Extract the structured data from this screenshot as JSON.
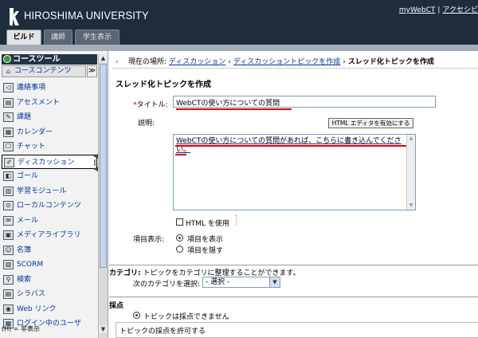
{
  "header": {
    "university": "HIROSHIMA UNIVERSITY",
    "links": [
      "myWebCT",
      "アクセシビ"
    ],
    "separator": "|"
  },
  "tabs": [
    {
      "label": "ビルド",
      "active": true
    },
    {
      "label": "講師",
      "active": false
    },
    {
      "label": "学生表示",
      "active": false
    }
  ],
  "sidebar": {
    "heading": "コースツール",
    "subheading": "コースコンテンツ",
    "collapse_icon": "≫",
    "items": [
      {
        "label": "連絡事項",
        "icon": "megaphone-icon",
        "glyph": "◁"
      },
      {
        "label": "アセスメント",
        "icon": "assessment-icon",
        "glyph": "▤"
      },
      {
        "label": "課題",
        "icon": "assignment-icon",
        "glyph": "✎"
      },
      {
        "label": "カレンダー",
        "icon": "calendar-icon",
        "glyph": "▦"
      },
      {
        "label": "チャット",
        "icon": "chat-icon",
        "glyph": "☐"
      },
      {
        "label": "ディスカッション",
        "icon": "discussion-icon",
        "glyph": "✐",
        "selected": true
      },
      {
        "label": "ゴール",
        "icon": "goal-icon",
        "glyph": "◧"
      },
      {
        "label": "学習モジュール",
        "icon": "learning-module-icon",
        "glyph": "▥"
      },
      {
        "label": "ローカルコンテンツ",
        "icon": "local-content-icon",
        "glyph": "⊙"
      },
      {
        "label": "メール",
        "icon": "mail-icon",
        "glyph": "✉"
      },
      {
        "label": "メディアライブラリ",
        "icon": "media-library-icon",
        "glyph": "▣"
      },
      {
        "label": "名簿",
        "icon": "roster-icon",
        "glyph": "☺"
      },
      {
        "label": "SCORM",
        "icon": "scorm-icon",
        "glyph": "▧"
      },
      {
        "label": "検索",
        "icon": "search-icon",
        "glyph": "⚲"
      },
      {
        "label": "シラバス",
        "icon": "syllabus-icon",
        "glyph": "▤"
      },
      {
        "label": "Web リンク",
        "icon": "web-link-icon",
        "glyph": "◉"
      },
      {
        "label": "ログイン中のユーザ",
        "icon": "online-users-icon",
        "glyph": "▦"
      }
    ],
    "footer_note": "(H) = 非表示"
  },
  "breadcrumb": {
    "prefix": "現在の場所:",
    "links": [
      "ディスカッション",
      "ディスカッショントピックを作成"
    ],
    "current": "スレッド化トピックを作成",
    "arrow": "›",
    "back_icon": "‹"
  },
  "form": {
    "page_title": "スレッド化トピックを作成",
    "title_required_mark": "*",
    "title_label": "タイトル:",
    "title_value": "WebCTの使い方についての質問",
    "description_label": "説明:",
    "html_editor_button": "HTML エディタを有効にする",
    "description_value": "WebCTの使い方についての質問があれば、こちらに書き込んでください。",
    "use_html_label": "HTML を使用",
    "use_html_checked": false,
    "display_label": "項目表示:",
    "display_options": [
      {
        "label": "項目を表示",
        "selected": true
      },
      {
        "label": "項目を隠す",
        "selected": false
      }
    ]
  },
  "category": {
    "label": "カテゴリ:",
    "description": "トピックをカテゴリに整理することができます。",
    "select_label": "次のカテゴリを選択:",
    "select_value": "- 選択 -"
  },
  "grading": {
    "heading": "採点",
    "option_label": "トピックは採点できません",
    "option_selected": true,
    "allow_label": "トピックの採点を許可する"
  },
  "colors": {
    "header_bg": "#1e2c3c",
    "link": "#003399",
    "annotation_red": "#e00000"
  }
}
